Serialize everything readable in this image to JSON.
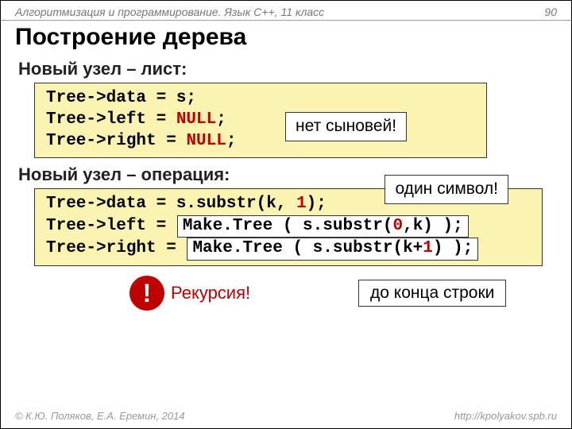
{
  "header": {
    "left": "Алгоритмизация и программирование. Язык C++, 11 класс",
    "page": "90"
  },
  "title": "Построение дерева",
  "leaf": {
    "heading": "Новый узел – лист:",
    "line1_a": "Tree->data = s;",
    "line2_a": "Tree->left = ",
    "line2_null": "NULL",
    "line2_b": ";",
    "line3_a": "Tree->right = ",
    "line3_null": "NULL",
    "line3_b": ";",
    "callout": "нет сыновей!"
  },
  "op": {
    "heading": "Новый узел – операция:",
    "callout": "один символ!",
    "l1a": "Tree->data = s.substr(k, ",
    "l1n": "1",
    "l1b": ");",
    "l2a": "Tree->left = ",
    "l2box_a": "Make.Tree ( s.substr(",
    "l2box_n": "0",
    "l2box_b": ",k) );",
    "l3a": "Tree->right = ",
    "l3box_a": "Make.Tree ( s.substr(k+",
    "l3box_n": "1",
    "l3box_b": ") );"
  },
  "recursion": {
    "bang": "!",
    "label": "Рекурсия!",
    "endcallout": "до конца строки"
  },
  "footer": {
    "left": "© К.Ю. Поляков, Е.А. Еремин, 2014",
    "right": "http://kpolyakov.spb.ru"
  }
}
